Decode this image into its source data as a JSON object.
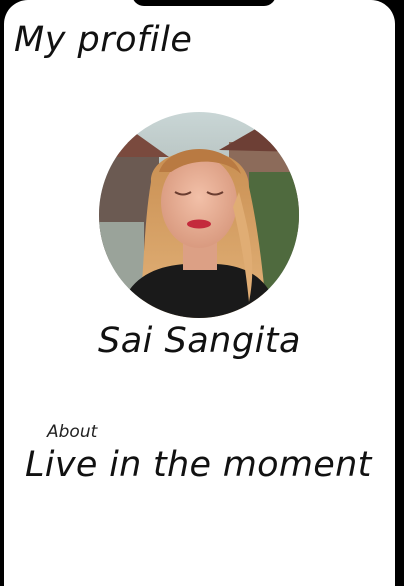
{
  "header": {
    "title": "My profile"
  },
  "profile": {
    "avatar_icon": "profile-photo",
    "name": "Sai Sangita",
    "about_label": "About",
    "about_text": "Live in the moment"
  },
  "colors": {
    "background": "#ffffff",
    "frame": "#000000",
    "text": "#111111"
  }
}
